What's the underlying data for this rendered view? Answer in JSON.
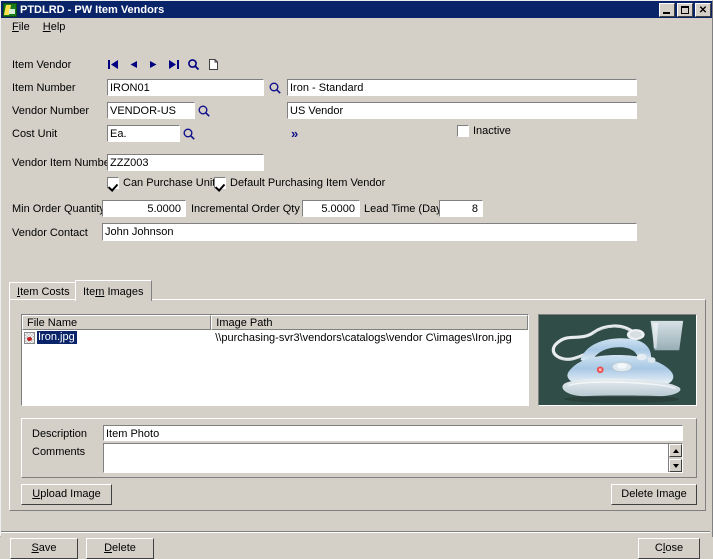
{
  "window": {
    "title": "PTDLRD - PW Item Vendors",
    "icon": "app-flag-icon",
    "controls": {
      "minimize": "minimize-icon",
      "maximize": "maximize-icon",
      "close": "✕"
    }
  },
  "menu": {
    "items": [
      {
        "label": "File",
        "accel": "F"
      },
      {
        "label": "Help",
        "accel": "H"
      }
    ]
  },
  "form": {
    "item_vendor_label": "Item Vendor",
    "nav_buttons": [
      "first-record-icon",
      "previous-record-icon",
      "next-record-icon",
      "last-record-icon",
      "find-record-icon",
      "new-record-icon"
    ],
    "item_number_label": "Item Number",
    "item_number_value": "IRON01",
    "item_description_value": "Iron - Standard",
    "vendor_number_label": "Vendor Number",
    "vendor_number_value": "VENDOR-US",
    "vendor_name_value": "US Vendor",
    "cost_unit_label": "Cost Unit",
    "cost_unit_value": "Ea.",
    "expand_chevron": "»",
    "inactive_label": "Inactive",
    "inactive_checked": false,
    "vendor_item_number_label": "Vendor Item Number",
    "vendor_item_number_value": "ZZZ003",
    "can_purchase_unit_label": "Can Purchase Unit",
    "can_purchase_unit_checked": true,
    "default_purchasing_item_vendor_label": "Default Purchasing Item Vendor",
    "default_purchasing_item_vendor_checked": true,
    "min_order_quantity_label": "Min Order Quantity",
    "min_order_quantity_value": "5.0000",
    "incremental_order_qty_label": "Incremental Order Qty",
    "incremental_order_qty_value": "5.0000",
    "lead_time_label": "Lead Time (Days)",
    "lead_time_value": "8",
    "vendor_contact_label": "Vendor Contact",
    "vendor_contact_value": "John Johnson"
  },
  "tabs": [
    {
      "label": "Item Costs",
      "accel": "I",
      "active": false
    },
    {
      "label": "Item Images",
      "accel": "m",
      "active": true
    }
  ],
  "grid": {
    "columns": [
      "File Name",
      "Image Path"
    ],
    "rows": [
      {
        "file_name": "Iron.jpg",
        "image_path": "\\\\purchasing-svr3\\vendors\\catalogs\\vendor C\\images\\Iron.jpg",
        "selected": true,
        "icon": "image-file-icon"
      }
    ]
  },
  "preview": {
    "alt": "steam-iron-photo"
  },
  "details": {
    "description_label": "Description",
    "description_value": "Item Photo",
    "comments_label": "Comments",
    "comments_value": ""
  },
  "actions": {
    "upload_image": "Upload Image",
    "upload_image_accel": "U",
    "delete_image": "Delete Image",
    "save": "Save",
    "save_accel": "S",
    "delete": "Delete",
    "delete_accel": "D",
    "close": "Close",
    "close_accel": "l"
  },
  "colors": {
    "window_face": "#d4d0c8",
    "title_bar": "#0a246a",
    "selection": "#0a246a",
    "link_blue": "#10108c",
    "field_white": "#ffffff"
  }
}
